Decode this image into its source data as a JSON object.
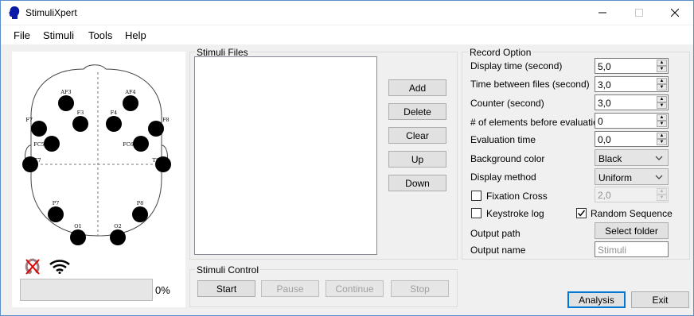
{
  "window": {
    "title": "StimuliXpert",
    "minimize_icon": "minimize-icon",
    "maximize_icon": "maximize-icon",
    "close_icon": "close-icon"
  },
  "menu": [
    "File",
    "Stimuli",
    "Tools",
    "Help"
  ],
  "head_panel": {
    "electrodes": [
      "AF3",
      "AF4",
      "F3",
      "F4",
      "F7",
      "F8",
      "FC5",
      "FC6",
      "T7",
      "T8",
      "P7",
      "P8",
      "O1",
      "O2"
    ],
    "headset_icon": "headset-disconnected-icon",
    "signal_icon": "wifi-signal-icon",
    "progress_fraction": 0,
    "progress_text": "0%"
  },
  "stimuli_files": {
    "title": "Stimuli Files",
    "buttons": {
      "add": "Add",
      "delete": "Delete",
      "clear": "Clear",
      "up": "Up",
      "down": "Down"
    }
  },
  "stimuli_control": {
    "title": "Stimuli Control",
    "start": "Start",
    "pause": "Pause",
    "continue": "Continue",
    "stop": "Stop"
  },
  "record_option": {
    "title": "Record Option",
    "display_time": {
      "label": "Display time (second)",
      "value": "5,0"
    },
    "time_between": {
      "label": "Time between files (second)",
      "value": "3,0"
    },
    "counter": {
      "label": "Counter (second)",
      "value": "3,0"
    },
    "elements_before": {
      "label": "# of elements before evaluation",
      "value": "0"
    },
    "evaluation_time": {
      "label": "Evaluation time",
      "value": "0,0"
    },
    "background_color": {
      "label": "Background color",
      "value": "Black"
    },
    "display_method": {
      "label": "Display method",
      "value": "Uniform"
    },
    "fixation_cross": {
      "label": "Fixation Cross",
      "checked": false,
      "value": "2,0"
    },
    "keystroke_log": {
      "label": "Keystroke log",
      "checked": false
    },
    "random_sequence": {
      "label": "Random Sequence",
      "checked": true
    },
    "output_path": {
      "label": "Output path",
      "button": "Select  folder"
    },
    "output_name": {
      "label": "Output name",
      "placeholder": "Stimuli"
    }
  },
  "footer": {
    "analysis": "Analysis",
    "exit": "Exit"
  }
}
